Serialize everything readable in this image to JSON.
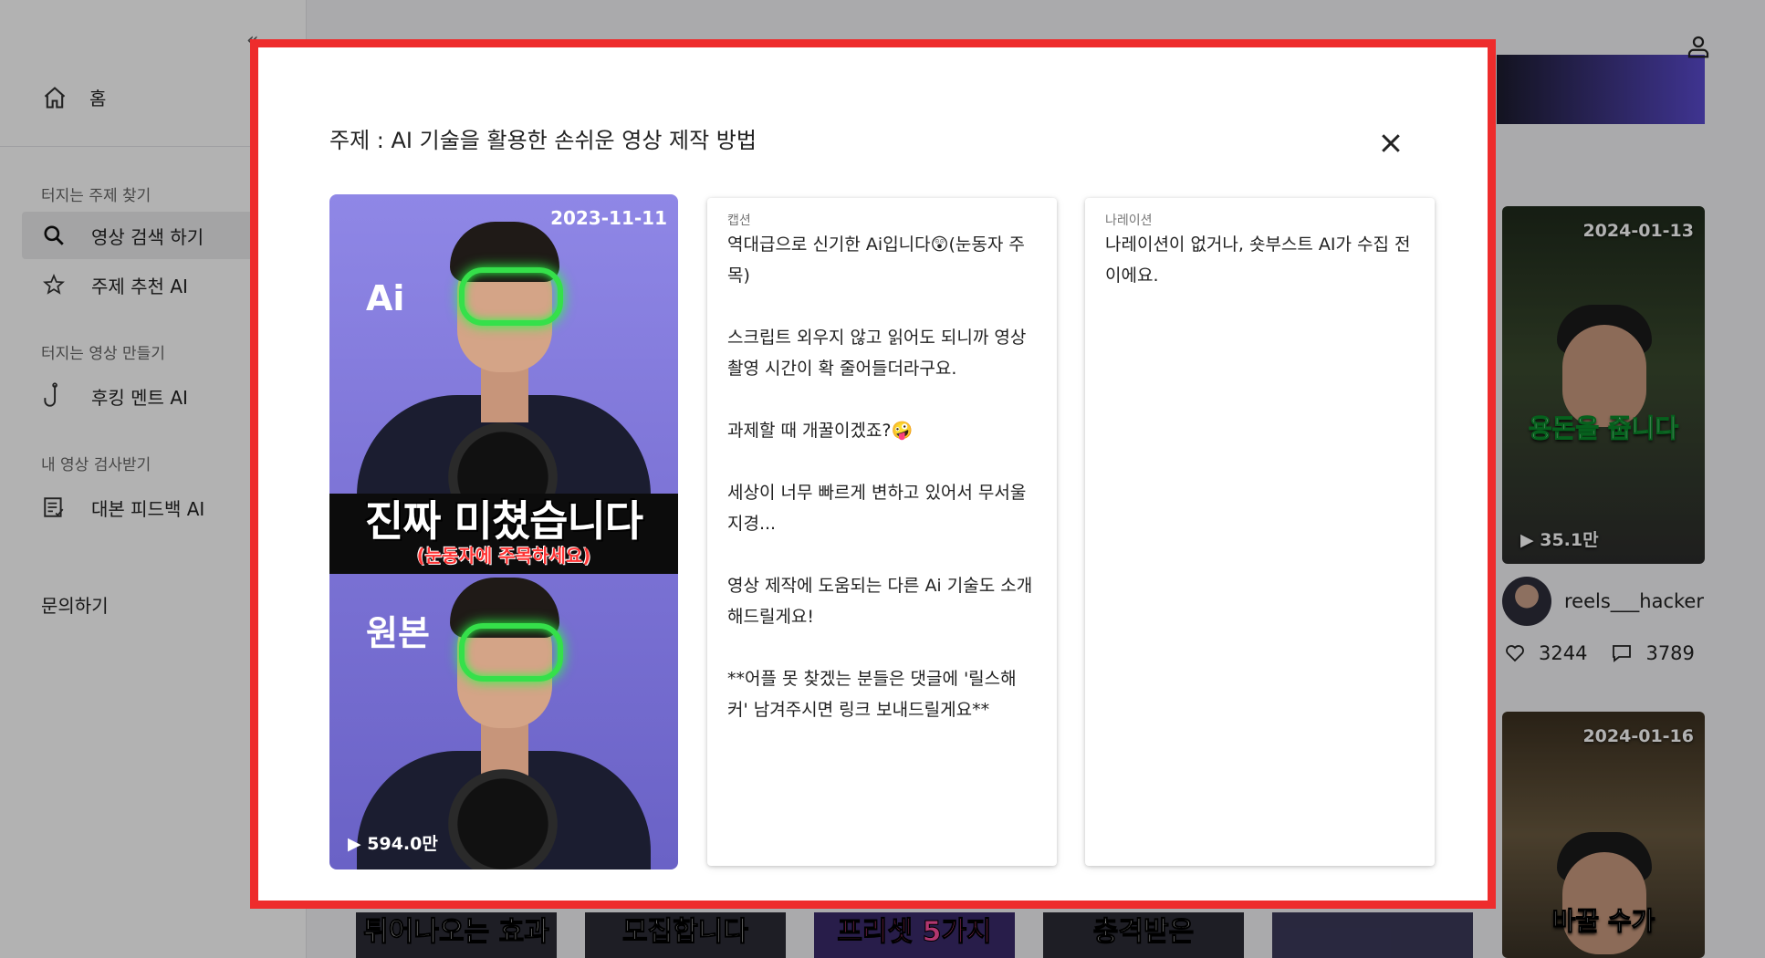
{
  "sidebar": {
    "home_label": "홈",
    "sections": [
      {
        "title": "터지는 주제 찾기",
        "items": [
          {
            "label": "영상 검색 하기",
            "icon": "search-icon",
            "active": true
          },
          {
            "label": "주제 추천 AI",
            "icon": "star-icon"
          }
        ]
      },
      {
        "title": "터지는 영상 만들기",
        "items": [
          {
            "label": "후킹 멘트 AI",
            "icon": "hook-icon"
          }
        ]
      },
      {
        "title": "내 영상 검사받기",
        "items": [
          {
            "label": "대본 피드백 AI",
            "icon": "script-icon"
          }
        ]
      }
    ],
    "inquiry_label": "문의하기"
  },
  "background": {
    "cards": [
      {
        "date": "2024-01-13",
        "caption": "용돈을 줍니다",
        "views": "35.1만"
      },
      {
        "date": "2024-01-16",
        "caption": "바꿀 수가",
        "views": ""
      }
    ],
    "author": {
      "name": "reels___hacker",
      "likes": "3244",
      "comments": "3789"
    },
    "bottom_thumbs": [
      "튀어나오는 효과",
      "모집합니다",
      "프리셋 5가지",
      "충격받은",
      ""
    ]
  },
  "modal": {
    "title": "주제 : AI 기술을 활용한 손쉬운 영상 제작 방법",
    "video": {
      "date": "2023-11-11",
      "label_top": "Ai",
      "label_bottom": "원본",
      "headline": "진짜 미쳤습니다",
      "subline": "(눈동자에 주목하세요)",
      "views": "594.0만"
    },
    "caption": {
      "label": "캡션",
      "paragraphs": [
        "역대급으로 신기한 Ai입니다😲(눈동자 주목)",
        "스크립트 외우지 않고 읽어도 되니까 영상 촬영 시간이 확 줄어들더라구요.",
        "과제할 때 개꿀이겠죠?🤪",
        "세상이 너무 빠르게 변하고 있어서 무서울 지경...",
        "영상 제작에 도움되는 다른 Ai 기술도 소개해드릴게요!",
        "**어플 못 찾겠는 분들은 댓글에 '릴스해커' 남겨주시면 링크 보내드릴게요**"
      ]
    },
    "narration": {
      "label": "나레이션",
      "text": "나레이션이 없거나, 숏부스트 AI가 수집 전이에요."
    }
  },
  "colors": {
    "modal_border": "#ee2c2c",
    "glow": "#35e04a",
    "video_bg": "#8f87e6"
  }
}
